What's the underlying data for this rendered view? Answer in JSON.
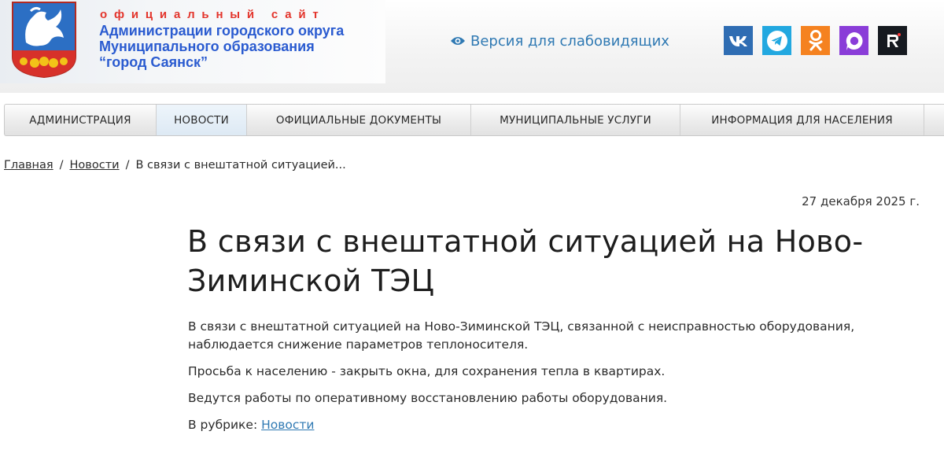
{
  "header": {
    "site_tag": "официальный сайт",
    "site_name_lines": [
      "Администрации городского округа",
      "Муниципального образования",
      "“город Саянск”"
    ],
    "low_vision_label": "Версия для слабовидящих",
    "socials": [
      {
        "name": "vk",
        "color": "#2f6db3"
      },
      {
        "name": "telegram",
        "color": "#22a8e0"
      },
      {
        "name": "odnoklassniki",
        "color": "#f58220"
      },
      {
        "name": "max",
        "color": "#8a3dd8"
      },
      {
        "name": "rutube",
        "color": "#161a20"
      }
    ]
  },
  "nav": {
    "items": [
      {
        "label": "АДМИНИСТРАЦИЯ",
        "active": false
      },
      {
        "label": "НОВОСТИ",
        "active": true
      },
      {
        "label": "ОФИЦИАЛЬНЫЕ ДОКУМЕНТЫ",
        "active": false
      },
      {
        "label": "МУНИЦИПАЛЬНЫЕ УСЛУГИ",
        "active": false
      },
      {
        "label": "ИНФОРМАЦИЯ ДЛЯ НАСЕЛЕНИЯ",
        "active": false
      },
      {
        "label": "",
        "active": false
      }
    ]
  },
  "breadcrumb": {
    "home": "Главная",
    "section": "Новости",
    "current": "В связи с внештатной ситуацией...",
    "separator": "/"
  },
  "article": {
    "date": "27 декабря 2025 г.",
    "title": "В связи с внештатной ситуацией на Ново-Зиминской ТЭЦ",
    "paragraphs": [
      "В связи с внештатной ситуацией на Ново-Зиминской ТЭЦ, связанной с неисправностью оборудования, наблюдается снижение параметров теплоносителя.",
      "Просьба к населению - закрыть окна, для сохранения тепла в квартирах.",
      "Ведутся работы по оперативному восстановлению работы оборудования."
    ],
    "rubric_label": "В рубрике:",
    "rubric_link": "Новости"
  },
  "colors": {
    "accent_blue": "#2a5bd0",
    "tag_red": "#e3352c",
    "link_blue": "#2f79b3"
  }
}
